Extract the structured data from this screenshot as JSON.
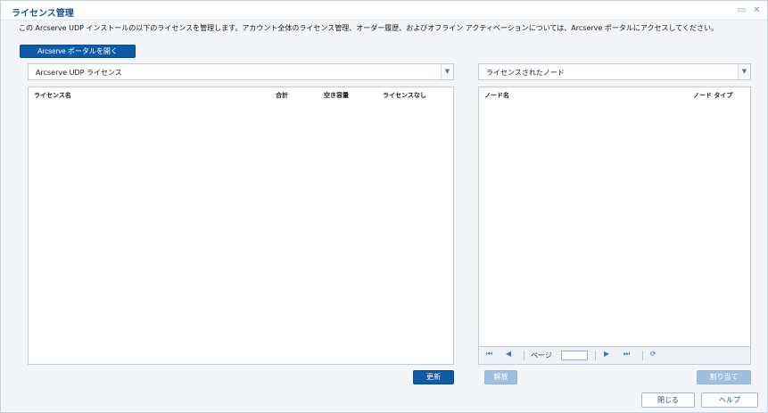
{
  "dialog": {
    "title": "ライセンス管理",
    "window_icons": [
      "restore-icon",
      "close-icon"
    ],
    "description": "この Arcserve UDP インストールの以下のライセンスを管理します。アカウント全体のライセンス管理、オーダー履歴、およびオフライン アクティベーションについては、Arcserve ポータルにアクセスしてください。",
    "open_portal_button": "Arcserve ポータルを開く"
  },
  "left_panel": {
    "combo_value": "Arcserve UDP ライセンス",
    "columns": [
      "ライセンス名",
      "合計",
      "空き容量",
      "ライセンスなし"
    ],
    "refresh_button": "更新"
  },
  "right_panel": {
    "combo_value": "ライセンスされたノード",
    "columns": [
      "ノード名",
      "ノード タイプ"
    ],
    "pager": {
      "page_label": "ページ",
      "page_value": ""
    },
    "release_button": "解放",
    "assign_button": "割り当て"
  },
  "footer": {
    "close_button": "閉じる",
    "help_button": "ヘルプ"
  },
  "colors": {
    "accent": "#0e5aa7",
    "title": "#1f4e8c",
    "panel_bg": "#e6ebf2"
  }
}
